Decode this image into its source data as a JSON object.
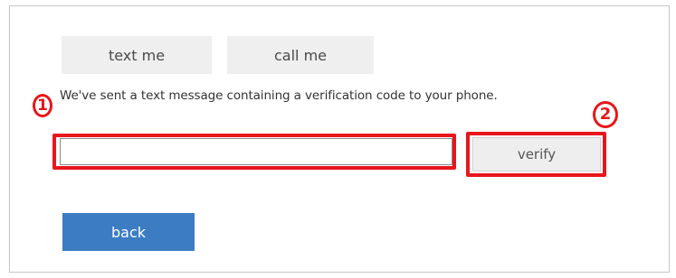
{
  "buttons": {
    "text_me": "text me",
    "call_me": "call me",
    "verify": "verify",
    "back": "back"
  },
  "message": "We've sent a text message containing a verification code to your phone.",
  "code_input": {
    "value": "",
    "placeholder": ""
  },
  "annotations": {
    "step_1": "1",
    "step_2": "2"
  },
  "colors": {
    "primary": "#3c7cc3",
    "annotation": "#e8161c",
    "secondary_button": "#efefef"
  }
}
